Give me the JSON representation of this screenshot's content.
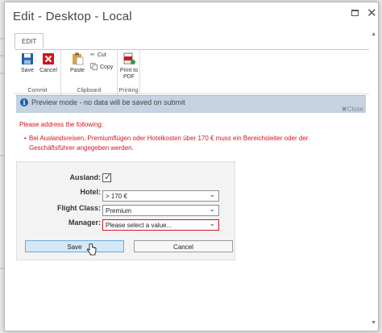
{
  "window": {
    "title": "Edit - Desktop - Local",
    "maximize_glyph": "□",
    "close_glyph": "✕"
  },
  "ribbon": {
    "tab": "EDIT",
    "groups": {
      "commit": {
        "label": "Commit",
        "save": "Save",
        "cancel": "Cancel"
      },
      "clipboard": {
        "label": "Clipboard",
        "paste": "Paste",
        "cut": "Cut",
        "copy": "Copy"
      },
      "printing": {
        "label": "Printing",
        "print_line1": "Print to",
        "print_line2": "PDF"
      }
    }
  },
  "preview": {
    "icon": "i",
    "message": "Preview mode - no data will be saved on submit",
    "close": "✖Close"
  },
  "errors": {
    "heading": "Please address the following:",
    "items": [
      "Bei Auslandsreisen, Premiumflügen oder Hotelkosten über 170 € muss ein Bereichsleiter oder der Geschäftsführer angegeben werden."
    ]
  },
  "form": {
    "ausland": {
      "label": "Ausland:",
      "checked": true,
      "check_glyph": "✓"
    },
    "hotel": {
      "label": "Hotel:",
      "value": "> 170 €"
    },
    "flight_class": {
      "label": "Flight Class:",
      "value": "Premium"
    },
    "manager": {
      "label": "Manager:",
      "value": "Please select a value..."
    },
    "save": "Save",
    "cancel": "Cancel"
  },
  "colors": {
    "error": "#d3141d",
    "preview_bar": "#c5d2e2",
    "accent": "#1f5fa8"
  }
}
